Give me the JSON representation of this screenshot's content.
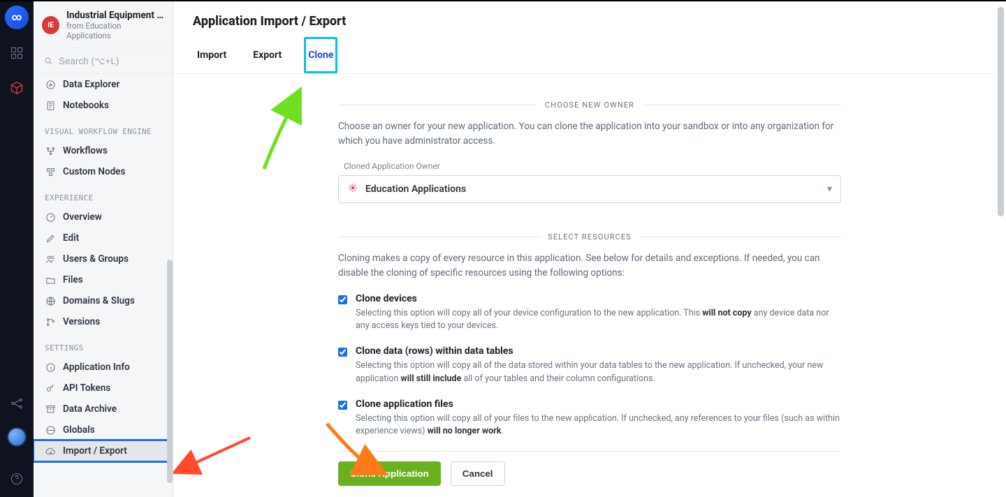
{
  "rail": {
    "logo_glyph": "∞"
  },
  "app": {
    "badge": "IE",
    "title": "Industrial Equipment …",
    "subtitle": "from Education Applications"
  },
  "search": {
    "placeholder": "Search (⌥+L)"
  },
  "nav": {
    "top": [
      {
        "label": "Data Explorer"
      },
      {
        "label": "Notebooks"
      }
    ],
    "section1_label": "VISUAL WORKFLOW ENGINE",
    "section1": [
      {
        "label": "Workflows"
      },
      {
        "label": "Custom Nodes"
      }
    ],
    "section2_label": "EXPERIENCE",
    "section2": [
      {
        "label": "Overview"
      },
      {
        "label": "Edit"
      },
      {
        "label": "Users & Groups"
      },
      {
        "label": "Files"
      },
      {
        "label": "Domains & Slugs"
      },
      {
        "label": "Versions"
      }
    ],
    "section3_label": "SETTINGS",
    "section3": [
      {
        "label": "Application Info"
      },
      {
        "label": "API Tokens"
      },
      {
        "label": "Data Archive"
      },
      {
        "label": "Globals"
      },
      {
        "label": "Import / Export"
      }
    ]
  },
  "page_title": "Application Import / Export",
  "tabs": [
    {
      "label": "Import"
    },
    {
      "label": "Export"
    },
    {
      "label": "Clone"
    }
  ],
  "owner": {
    "heading": "CHOOSE NEW OWNER",
    "desc": "Choose an owner for your new application. You can clone the application into your sandbox or into any organization for which you have administrator access.",
    "field_label": "Cloned Application Owner",
    "selected": "Education Applications"
  },
  "resources": {
    "heading": "SELECT RESOURCES",
    "desc": "Cloning makes a copy of every resource in this application. See below for details and exceptions. If needed, you can disable the cloning of specific resources using the following options:",
    "opts": [
      {
        "title": "Clone devices",
        "pre": "Selecting this option will copy all of your device configuration to the new application. This ",
        "bold": "will not copy",
        "post": " any device data nor any access keys tied to your devices."
      },
      {
        "title": "Clone data (rows) within data tables",
        "pre": "Selecting this option will copy all of the data stored within your data tables to the new application. If unchecked, your new application ",
        "bold": "will still include",
        "post": " all of your tables and their column configurations."
      },
      {
        "title": "Clone application files",
        "pre": "Selecting this option will copy all of your files to the new application. If unchecked, any references to your files (such as within experience views) ",
        "bold": "will no longer work",
        "post": "."
      }
    ]
  },
  "actions": {
    "primary": "Clone Application",
    "secondary": "Cancel"
  }
}
